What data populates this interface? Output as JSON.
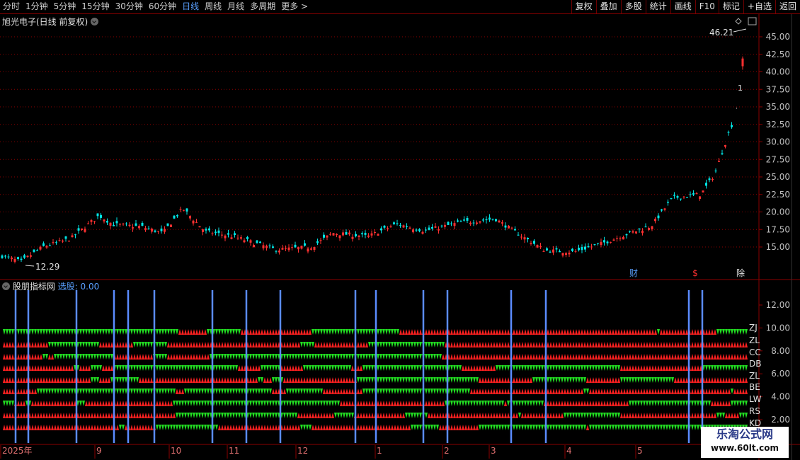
{
  "toolbar": {
    "periods": [
      "分时",
      "1分钟",
      "5分钟",
      "15分钟",
      "30分钟",
      "60分钟",
      "日线",
      "周线",
      "月线",
      "多周期",
      "更多 >"
    ],
    "active_period": "日线",
    "buttons": [
      "复权",
      "叠加",
      "多股",
      "统计",
      "画线",
      "F10",
      "标记",
      "+自选",
      "返回"
    ]
  },
  "main_panel": {
    "title": "旭光电子(日线 前复权)",
    "high_label": "46.21",
    "low_label": "12.29",
    "price_axis": [
      "45.00",
      "42.50",
      "40.00",
      "37.50",
      "35.00",
      "32.50",
      "30.00",
      "27.50",
      "25.00",
      "22.50",
      "20.00",
      "17.50",
      "15.00"
    ],
    "markers": [
      {
        "text": "财",
        "color": "#5aa0ff"
      },
      {
        "text": "$",
        "color": "#ff3030"
      },
      {
        "text": "除",
        "color": "#e0e0e0"
      }
    ],
    "colors": {
      "up": "#ff3030",
      "down": "#00e5e5",
      "grid": "#8b0000",
      "axis": "#8b0000"
    }
  },
  "indicator_panel": {
    "title": "股朋指标网",
    "select_label": "选股: 0.00",
    "axis": [
      "12.00",
      "10.00",
      "8.00",
      "6.00",
      "4.00",
      "2.00"
    ],
    "row_labels": [
      "ZJ",
      "ZL",
      "CC",
      "DB",
      "ZL",
      "BE",
      "LW",
      "RS",
      "KD"
    ],
    "colors": {
      "red": "#ff2020",
      "green": "#22dd22",
      "line": "#5b8cff"
    }
  },
  "x_axis": {
    "labels": [
      "2025年",
      "9",
      "10",
      "11",
      "12",
      "1",
      "2",
      "3",
      "4",
      "5"
    ]
  },
  "watermark": {
    "line1": "乐淘公式网",
    "line2": "www.60lt.com"
  }
}
